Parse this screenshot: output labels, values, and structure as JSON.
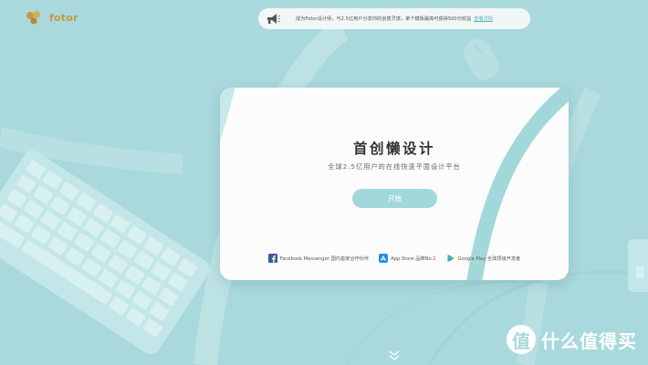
{
  "brand": {
    "logo_text": "fotor",
    "color": "#c39a40"
  },
  "banner": {
    "text": "成为Fotor设计师，与2.5亿用户分享你的创意灵感，单个模板最高可获得500元收益",
    "link": "查看详情",
    "icon": "megaphone-icon"
  },
  "hero": {
    "title": "首创懒设计",
    "subtitle": "全球2.5亿用户的在线快速平面设计平台",
    "cta": "开始"
  },
  "partners": [
    {
      "icon": "facebook-icon",
      "label": "Facebook Messenger 国内首家合作伙伴"
    },
    {
      "icon": "app-store-icon",
      "label": "App Store 品牌No.1"
    },
    {
      "icon": "google-play-icon",
      "label": "Google Play 全球顶级开发者"
    }
  ],
  "scroll_hint_icon": "double-chevron-down-icon",
  "watermark": {
    "badge": "值",
    "text": "什么值得买"
  },
  "colors": {
    "background": "#a9d9dc",
    "accent": "#a3d8db",
    "link": "#4db3be",
    "card": "#fbfcfb"
  }
}
